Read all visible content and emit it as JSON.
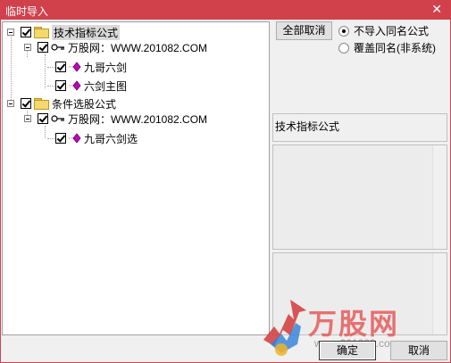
{
  "window": {
    "title": "临时导入",
    "close_glyph": "✕"
  },
  "tree": {
    "groups": [
      {
        "label": "技术指标公式",
        "children": [
          {
            "label": "万股网：WWW.201082.COM",
            "items": [
              "九哥六剑",
              "六剑主图"
            ]
          }
        ]
      },
      {
        "label": "条件选股公式",
        "children": [
          {
            "label": "万股网：WWW.201082.COM",
            "items": [
              "九哥六剑选"
            ]
          }
        ]
      }
    ]
  },
  "right": {
    "cancel_all_label": "全部取消",
    "radio_options": [
      "不导入同名公式",
      "覆盖同名(非系统)"
    ],
    "selected_radio": 0,
    "panel_title": "技术指标公式"
  },
  "footer": {
    "ok_label": "确定",
    "cancel_label": "取消"
  },
  "watermark": {
    "brand": "万股网",
    "url": "www.201082.com"
  },
  "colors": {
    "titlebar": "#d1414c",
    "accent_red": "#e85b5b"
  }
}
